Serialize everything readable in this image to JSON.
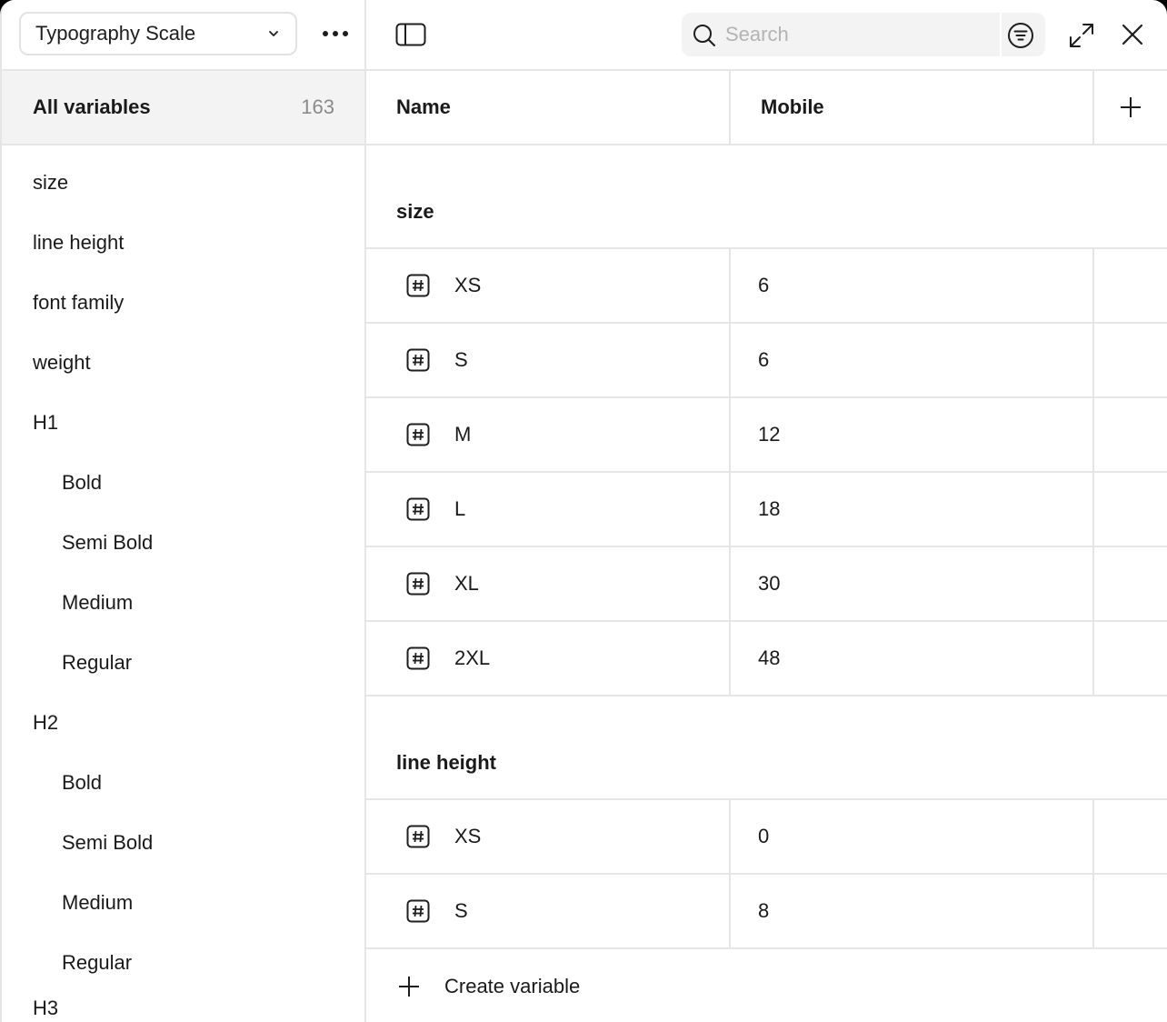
{
  "sidebar": {
    "collection": "Typography Scale",
    "all_variables": {
      "label": "All variables",
      "count": "163"
    },
    "groups": [
      {
        "label": "size",
        "level": 0
      },
      {
        "label": "line height",
        "level": 0
      },
      {
        "label": "font family",
        "level": 0
      },
      {
        "label": "weight",
        "level": 0
      },
      {
        "label": "H1",
        "level": 0
      },
      {
        "label": "Bold",
        "level": 1
      },
      {
        "label": "Semi Bold",
        "level": 1
      },
      {
        "label": "Medium",
        "level": 1
      },
      {
        "label": "Regular",
        "level": 1
      },
      {
        "label": "H2",
        "level": 0
      },
      {
        "label": "Bold",
        "level": 1
      },
      {
        "label": "Semi Bold",
        "level": 1
      },
      {
        "label": "Medium",
        "level": 1
      },
      {
        "label": "Regular",
        "level": 1
      },
      {
        "label": "H3",
        "level": 0
      }
    ]
  },
  "toolbar": {
    "search_placeholder": "Search",
    "icons": [
      "sidebar-toggle-icon",
      "search-icon",
      "filter-icon",
      "expand-icon",
      "close-icon"
    ]
  },
  "table": {
    "columns": {
      "name": "Name",
      "mode": "Mobile"
    },
    "sections": [
      {
        "title": "size",
        "rows": [
          {
            "name": "XS",
            "value": "6"
          },
          {
            "name": "S",
            "value": "6"
          },
          {
            "name": "M",
            "value": "12"
          },
          {
            "name": "L",
            "value": "18"
          },
          {
            "name": "XL",
            "value": "30"
          },
          {
            "name": "2XL",
            "value": "48"
          }
        ]
      },
      {
        "title": "line height",
        "rows": [
          {
            "name": "XS",
            "value": "0"
          },
          {
            "name": "S",
            "value": "8"
          }
        ]
      }
    ],
    "create_label": "Create variable"
  },
  "colors": {
    "border": "#e6e6e6",
    "selected_bg": "#f3f3f3",
    "text": "#1a1a1a",
    "muted": "#8a8a8a"
  }
}
